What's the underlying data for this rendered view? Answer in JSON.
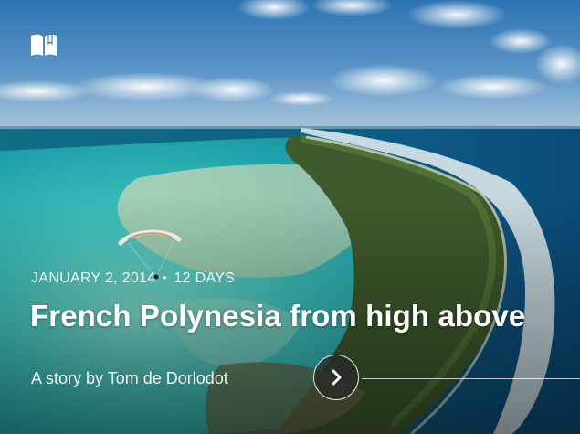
{
  "story": {
    "date": "JANUARY 2, 2014",
    "separator": "•",
    "duration": "12 DAYS",
    "title": "French Polynesia from high above",
    "byline": "A story by Tom de Dorlodot"
  },
  "icons": {
    "top_left": "book-open-icon",
    "next": "chevron-right-icon"
  },
  "colors": {
    "text": "#ffffff",
    "button_bg": "#2a2a2a"
  }
}
